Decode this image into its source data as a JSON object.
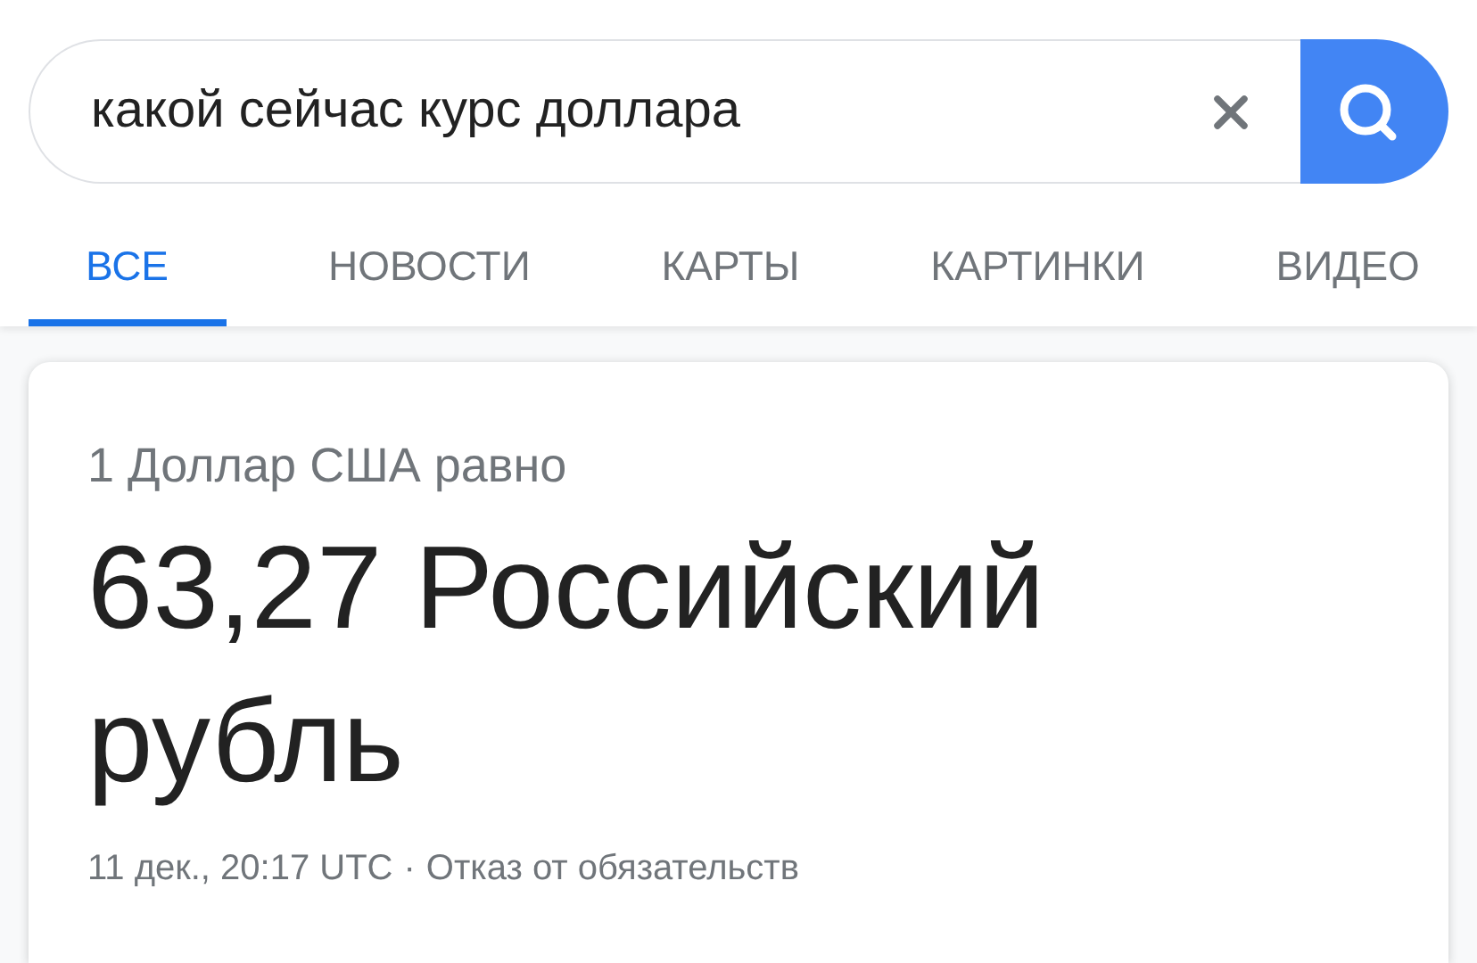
{
  "search": {
    "value": "какой сейчас курс доллара"
  },
  "tabs": [
    {
      "label": "ВСЕ",
      "selected": true
    },
    {
      "label": "НОВОСТИ",
      "selected": false
    },
    {
      "label": "КАРТЫ",
      "selected": false
    },
    {
      "label": "КАРТИНКИ",
      "selected": false
    },
    {
      "label": "ВИДЕО",
      "selected": false
    }
  ],
  "result": {
    "from": "1 Доллар США равно",
    "amount": "63,27 Российский рубль",
    "time": "11 дек., 20:17 UTC",
    "separator": "·",
    "disclaimer": "Отказ от обязательств"
  }
}
